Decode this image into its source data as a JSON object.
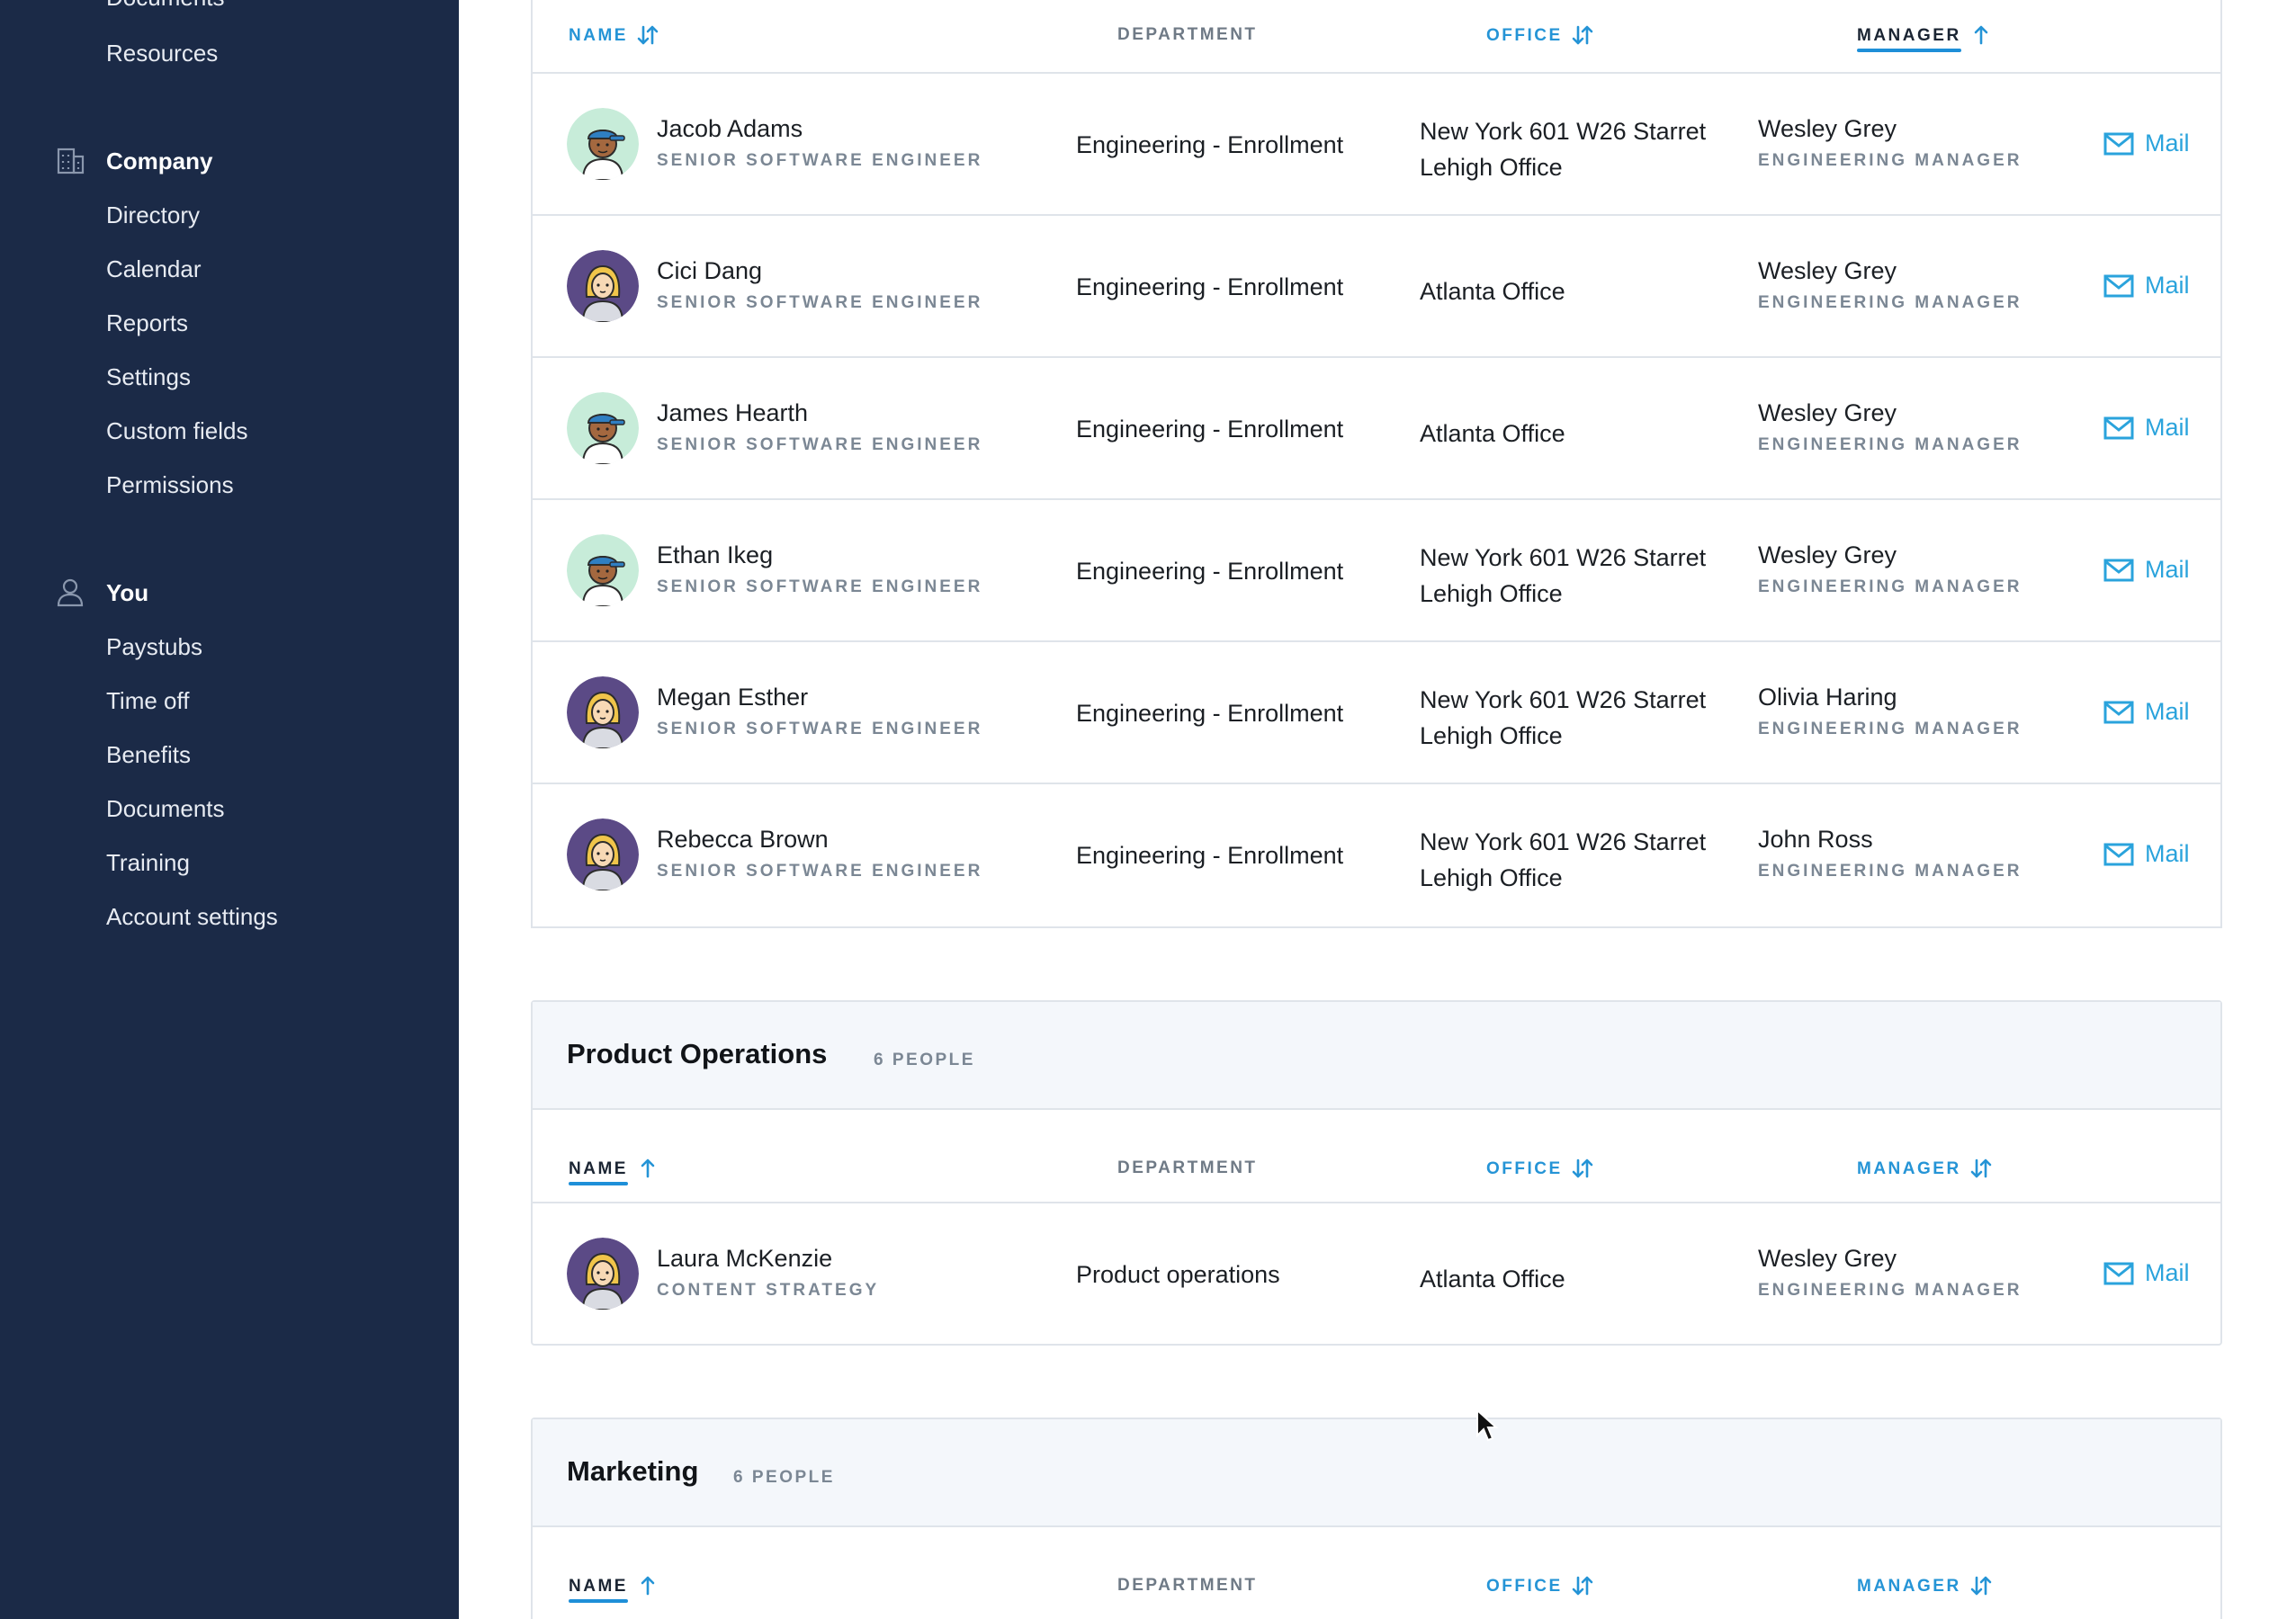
{
  "sidebar": {
    "top_partial_item": "Documents",
    "resources": "Resources",
    "company": {
      "title": "Company",
      "icon": "building-icon",
      "items": [
        "Directory",
        "Calendar",
        "Reports",
        "Settings",
        "Custom fields",
        "Permissions"
      ]
    },
    "you": {
      "title": "You",
      "icon": "user-icon",
      "items": [
        "Paystubs",
        "Time off",
        "Benefits",
        "Documents",
        "Training",
        "Account settings"
      ]
    }
  },
  "columns": {
    "name": "NAME",
    "department": "DEPARTMENT",
    "office": "OFFICE",
    "manager": "MANAGER"
  },
  "mail_label": "Mail",
  "engineering": {
    "rows": [
      {
        "name": "Jacob Adams",
        "title": "SENIOR SOFTWARE ENGINEER",
        "department": "Engineering - Enrollment",
        "office_line1": "New York 601 W26 Starret",
        "office_line2": "Lehigh Office",
        "manager": "Wesley Grey",
        "manager_title": "ENGINEERING MANAGER",
        "avatar": "male-cap-avatar"
      },
      {
        "name": "Cici Dang",
        "title": "SENIOR SOFTWARE ENGINEER",
        "department": "Engineering - Enrollment",
        "office_line1": "Atlanta Office",
        "office_line2": "",
        "manager": "Wesley Grey",
        "manager_title": "ENGINEERING MANAGER",
        "avatar": "female-blonde-avatar"
      },
      {
        "name": "James Hearth",
        "title": "SENIOR SOFTWARE ENGINEER",
        "department": "Engineering - Enrollment",
        "office_line1": "Atlanta Office",
        "office_line2": "",
        "manager": "Wesley Grey",
        "manager_title": "ENGINEERING MANAGER",
        "avatar": "male-cap-avatar"
      },
      {
        "name": "Ethan Ikeg",
        "title": "SENIOR SOFTWARE ENGINEER",
        "department": "Engineering - Enrollment",
        "office_line1": "New York 601 W26 Starret",
        "office_line2": "Lehigh Office",
        "manager": "Wesley Grey",
        "manager_title": "ENGINEERING MANAGER",
        "avatar": "male-cap-avatar"
      },
      {
        "name": "Megan Esther",
        "title": "SENIOR SOFTWARE ENGINEER",
        "department": "Engineering - Enrollment",
        "office_line1": "New York 601 W26 Starret",
        "office_line2": "Lehigh Office",
        "manager": "Olivia Haring",
        "manager_title": "ENGINEERING MANAGER",
        "avatar": "female-blonde-avatar"
      },
      {
        "name": "Rebecca Brown",
        "title": "SENIOR SOFTWARE ENGINEER",
        "department": "Engineering - Enrollment",
        "office_line1": "New York 601 W26 Starret",
        "office_line2": "Lehigh Office",
        "manager": "John Ross",
        "manager_title": "ENGINEERING MANAGER",
        "avatar": "female-blonde-avatar"
      }
    ]
  },
  "product_ops": {
    "title": "Product Operations",
    "count": "6 PEOPLE",
    "rows": [
      {
        "name": "Laura McKenzie",
        "title": "CONTENT STRATEGY",
        "department": "Product operations",
        "office_line1": "Atlanta Office",
        "office_line2": "",
        "manager": "Wesley Grey",
        "manager_title": "ENGINEERING MANAGER",
        "avatar": "female-blonde-avatar"
      }
    ]
  },
  "marketing": {
    "title": "Marketing",
    "count": "6 PEOPLE"
  },
  "colors": {
    "sidebar_bg": "#1b2a47",
    "accent_blue": "#2594d6",
    "mail_blue": "#2aa3dc",
    "header_strip": "#f4f7fb",
    "muted_text": "#7b8794"
  }
}
